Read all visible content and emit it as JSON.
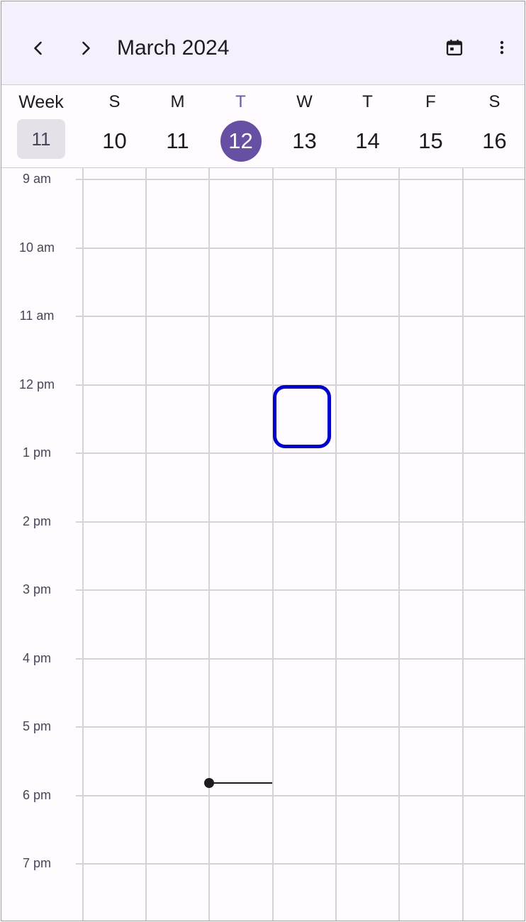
{
  "header": {
    "title": "March 2024",
    "prev_icon": "chevron-left-icon",
    "next_icon": "chevron-right-icon",
    "today_icon": "calendar-today-icon",
    "menu_icon": "more-vert-icon"
  },
  "week": {
    "label": "Week",
    "number": "11"
  },
  "days": [
    {
      "dow": "S",
      "date": "10",
      "today": false
    },
    {
      "dow": "M",
      "date": "11",
      "today": false
    },
    {
      "dow": "T",
      "date": "12",
      "today": true
    },
    {
      "dow": "W",
      "date": "13",
      "today": false
    },
    {
      "dow": "T",
      "date": "14",
      "today": false
    },
    {
      "dow": "F",
      "date": "15",
      "today": false
    },
    {
      "dow": "S",
      "date": "16",
      "today": false
    }
  ],
  "hours": [
    "9 am",
    "10 am",
    "11 am",
    "12 pm",
    "1 pm",
    "2 pm",
    "3 pm",
    "4 pm",
    "5 pm",
    "6 pm",
    "7 pm"
  ],
  "colors": {
    "accent": "#6750a4",
    "selection": "#0000cc",
    "header_bg": "#f4f1fc",
    "background": "#fffbff"
  }
}
